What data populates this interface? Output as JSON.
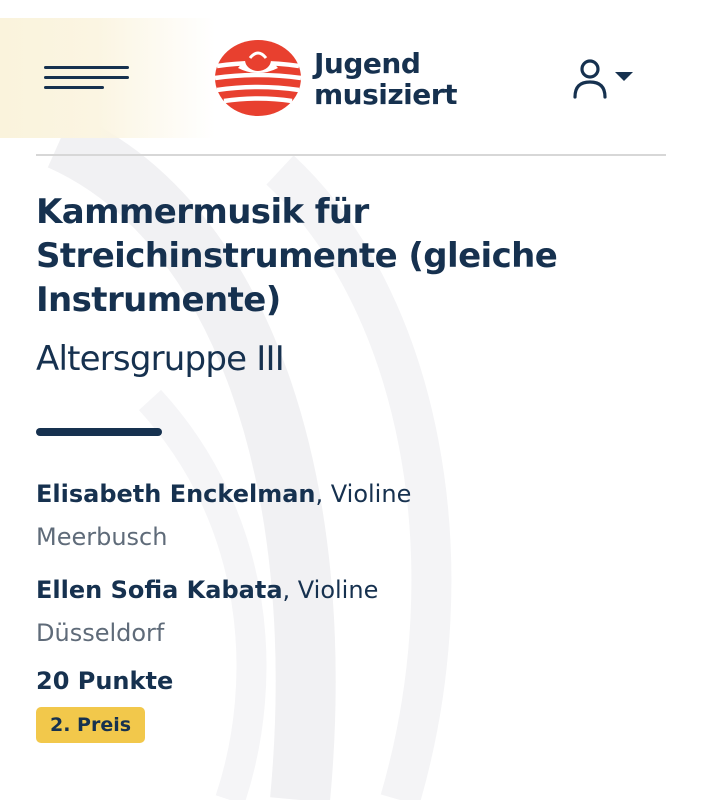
{
  "header": {
    "logo_line1": "Jugend",
    "logo_line2": "musiziert",
    "menu_icon": "hamburger-menu-icon",
    "account_icon": "user-icon",
    "account_dropdown_icon": "caret-down-icon"
  },
  "competition": {
    "title": "Kammermusik für Streichinstrumente (gleiche Instrumente)",
    "age_group": "Altersgruppe III"
  },
  "participants": [
    {
      "name": "Elisabeth Enckelman",
      "instrument_suffix": ", Violine",
      "city": "Meerbusch"
    },
    {
      "name": "Ellen Sofia Kabata",
      "instrument_suffix": ", Violine",
      "city": "Düsseldorf"
    }
  ],
  "result": {
    "points": "20 Punkte",
    "prize": "2. Preis"
  },
  "colors": {
    "text_primary": "#16314f",
    "text_secondary": "#5f6b79",
    "logo_red": "#e8402f",
    "prize_badge": "#f2c84b",
    "divider": "#d7d7d7"
  }
}
